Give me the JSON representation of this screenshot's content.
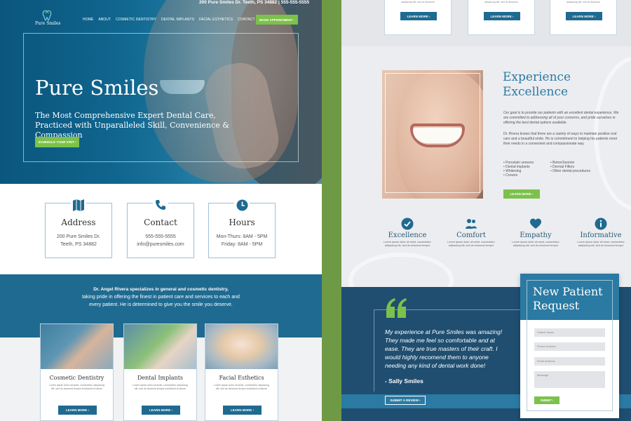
{
  "topbar": {
    "address": "200 Pure Smiles Dr.  Teeth, PS 34882  |  555-555-5555"
  },
  "brand": {
    "name": "Pure Smiles"
  },
  "nav": {
    "items": [
      "HOME",
      "ABOUT",
      "COSMETIC DENTISTRY",
      "DENTAL IMPLANTS",
      "FACIAL ESTHETICS",
      "CONTACT"
    ]
  },
  "buttons": {
    "book": "BOOK APPOINTMENT",
    "schedule": "SCHEDULE YOUR VISIT",
    "learn_more": "LEARN MORE",
    "submit_review": "SUBMIT A REVIEW",
    "submit": "SUBMIT"
  },
  "hero": {
    "title": "Pure Smiles",
    "subtitle": "The Most Comprehensive Expert Dental Care, Practiced with Unparalleled Skill, Convenience & Compassion"
  },
  "info_cards": [
    {
      "icon": "map-icon",
      "title": "Address",
      "lines": [
        "200 Pure Smiles Dr.",
        "Teeth, PS 34882"
      ]
    },
    {
      "icon": "phone-icon",
      "title": "Contact",
      "lines": [
        "555-555-5555",
        "info@puresmiles.com"
      ]
    },
    {
      "icon": "clock-icon",
      "title": "Hours",
      "lines": [
        "Mon-Thurs:  8AM - 5PM",
        "Friday:  8AM - 5PM"
      ]
    }
  ],
  "intro": {
    "bold": "Dr. Angel Rivera specializes in general and cosmetic dentistry,",
    "lines": [
      "taking pride in offering the finest in patient care and services to each and",
      "every patient. He is determined to give you the smile you deserve."
    ]
  },
  "services": [
    {
      "title": "Cosmetic Dentistry",
      "desc": "Lorem ipsum dolor sit amet, consectetur adipiscing elit, sed do eiusmod tempor incididunt ut labore"
    },
    {
      "title": "Dental Implants",
      "desc": "Lorem ipsum dolor sit amet, consectetur adipiscing elit, sed do eiusmod tempor incididunt ut labore"
    },
    {
      "title": "Facial Esthetics",
      "desc": "Lorem ipsum dolor sit amet, consectetur adipiscing elit, sed do eiusmod tempor incididunt ut labore"
    }
  ],
  "top_cards": [
    {
      "desc": "adipiscing elit, sed do eiusmod"
    },
    {
      "desc": "adipiscing elit, sed do eiusmod"
    },
    {
      "desc": "adipiscing elit, sed do eiusmod"
    }
  ],
  "experience": {
    "title_line1": "Experience",
    "title_line2": "Excellence",
    "lead": "Our goal is to provide our patients with an excellent dental experience. We are committed to addressing all of your concerns, and pride ourselves in offering the best dental options available.",
    "body": "Dr. Rivera knows that there are a variety of ways to maintain positive oral care and a beautiful smile. He is commitment to helping his patients meet their needs in a convenient and compassionate way.",
    "list_left": [
      "• Porcelain veneers",
      "• Dental implants",
      "• Whitening",
      "• Crowns"
    ],
    "list_right": [
      "• Botox/Xeomin",
      "• Dermal Fillers",
      "• Other dental procedures"
    ]
  },
  "features": [
    {
      "icon": "check-circle-icon",
      "title": "Excellence",
      "desc": "Lorem ipsum dolor sit amet, consectetur adipiscing elit, sed do eiusmod tempor"
    },
    {
      "icon": "people-icon",
      "title": "Comfort",
      "desc": "Lorem ipsum dolor sit amet, consectetur adipiscing elit, sed do eiusmod tempor"
    },
    {
      "icon": "heart-icon",
      "title": "Empathy",
      "desc": "Lorem ipsum dolor sit amet, consectetur adipiscing elit, sed do eiusmod tempor"
    },
    {
      "icon": "info-icon",
      "title": "Informative",
      "desc": "Lorem ipsum dolor sit amet, consectetur adipiscing elit, sed do eiusmod tempor"
    }
  ],
  "testimonial": {
    "text": "My experience at Pure Smiles was amazing! They made me feel so comfortable and at ease. They are true masters of their craft. I would highly recomend them to anyone needing any kind of dental work done!",
    "author": "- Sally Smiles"
  },
  "form": {
    "title_line1": "New Patient",
    "title_line2": "Request",
    "placeholders": [
      "Patient Name",
      "Phone Number",
      "Email Address",
      "Message"
    ]
  },
  "colors": {
    "primary": "#1f6a90",
    "accent": "#7cc14a",
    "dark": "#1f4e70",
    "divider": "#6f9a45"
  }
}
